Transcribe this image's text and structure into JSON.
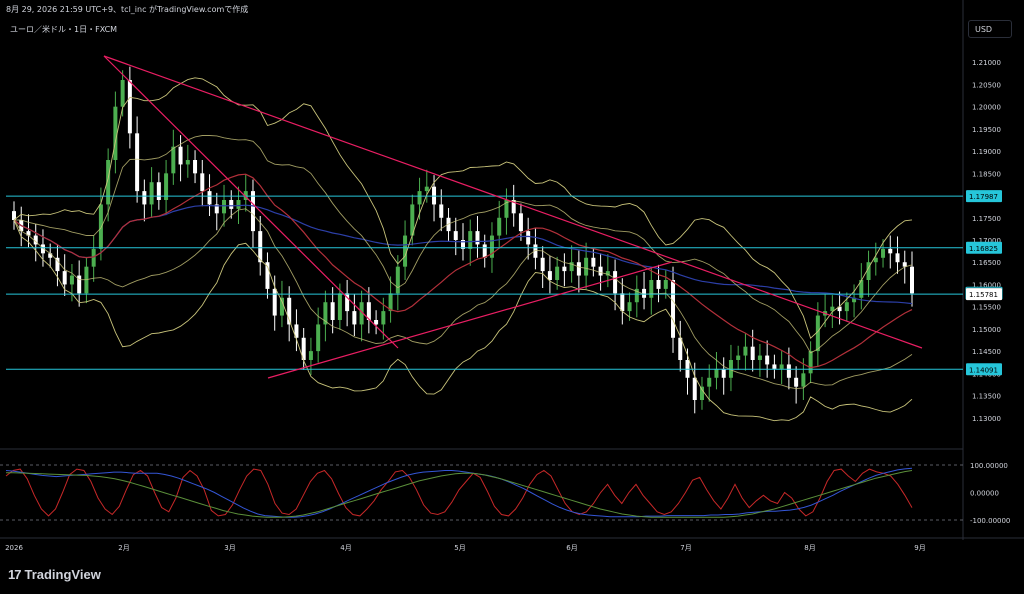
{
  "caption": "8月 29, 2026 21:59 UTC+9、tcl_inc がTradingView.comで作成",
  "symbol_label": "ユーロ／米ドル・1日・FXCM",
  "currency_button": "USD",
  "brand": {
    "mark": "17",
    "name": "TradingView"
  },
  "colors": {
    "background": "#000000",
    "bull": "#4caf50",
    "bear": "#ffffff",
    "hline": "#26c6da",
    "trend": "#e91e63",
    "bb": "#c8c37a",
    "ma_red": "#b2303a",
    "ma_blue": "#2c3fa8",
    "osc_red": "#c62828",
    "osc_blue": "#3456d6",
    "osc_green": "#5b8f3a"
  },
  "chart_data": [
    {
      "type": "candlestick",
      "title": "ユーロ／米ドル・1日・FXCM",
      "ylim": [
        1.125,
        1.215
      ],
      "yticks": [
        "1.21000",
        "1.20500",
        "1.20000",
        "1.19500",
        "1.19000",
        "1.18500",
        "1.18000",
        "1.17500",
        "1.17000",
        "1.16500",
        "1.16000",
        "1.15500",
        "1.15000",
        "1.14500",
        "1.14000",
        "1.13500",
        "1.13000"
      ],
      "xticks": [
        "2026",
        "2月",
        "3月",
        "4月",
        "5月",
        "6月",
        "7月",
        "8月",
        "9月"
      ],
      "price_levels": [
        {
          "label": "1.17987",
          "value": 1.17987
        },
        {
          "label": "1.16825",
          "value": 1.16825
        },
        {
          "label": "1.15801",
          "value": 1.15801,
          "style": "outline"
        },
        {
          "label": "1.15781",
          "value": 1.15781,
          "style": "plain"
        },
        {
          "label": "1.14091",
          "value": 1.14091
        }
      ],
      "close": [
        1.1745,
        1.172,
        1.171,
        1.169,
        1.167,
        1.166,
        1.163,
        1.16,
        1.162,
        1.158,
        1.164,
        1.168,
        1.178,
        1.188,
        1.2,
        1.206,
        1.194,
        1.181,
        1.178,
        1.183,
        1.179,
        1.185,
        1.191,
        1.187,
        1.188,
        1.185,
        1.181,
        1.178,
        1.176,
        1.179,
        1.177,
        1.179,
        1.181,
        1.172,
        1.165,
        1.159,
        1.153,
        1.157,
        1.151,
        1.148,
        1.143,
        1.145,
        1.151,
        1.156,
        1.152,
        1.158,
        1.154,
        1.151,
        1.156,
        1.152,
        1.151,
        1.154,
        1.158,
        1.164,
        1.171,
        1.178,
        1.181,
        1.182,
        1.178,
        1.175,
        1.172,
        1.17,
        1.168,
        1.172,
        1.169,
        1.166,
        1.171,
        1.175,
        1.179,
        1.176,
        1.172,
        1.169,
        1.166,
        1.163,
        1.161,
        1.164,
        1.163,
        1.165,
        1.162,
        1.166,
        1.164,
        1.162,
        1.163,
        1.158,
        1.154,
        1.156,
        1.159,
        1.157,
        1.161,
        1.159,
        1.161,
        1.148,
        1.143,
        1.139,
        1.134,
        1.137,
        1.139,
        1.141,
        1.139,
        1.143,
        1.144,
        1.146,
        1.143,
        1.144,
        1.142,
        1.141,
        1.142,
        1.139,
        1.137,
        1.14,
        1.145,
        1.153,
        1.154,
        1.155,
        1.154,
        1.156,
        1.157,
        1.161,
        1.165,
        1.166,
        1.168,
        1.167,
        1.165,
        1.164,
        1.158
      ]
    },
    {
      "type": "line",
      "title": "",
      "ylim": [
        -100,
        100
      ],
      "yticks": [
        "100.00000",
        "0.00000",
        "-100.00000"
      ],
      "series": [
        {
          "values": [
            60,
            80,
            85,
            50,
            -10,
            -60,
            -85,
            -60,
            0,
            65,
            85,
            80,
            40,
            -20,
            -60,
            -80,
            -50,
            10,
            65,
            80,
            60,
            0,
            -55,
            -70,
            -20,
            55,
            80,
            60,
            10,
            -65,
            -85,
            -80,
            -45,
            10,
            60,
            85,
            80,
            30,
            -40,
            -75,
            -80,
            -60,
            -10,
            40,
            70,
            80,
            50,
            -5,
            -55,
            -80,
            -85,
            -60,
            -30,
            10,
            40,
            75,
            80,
            55,
            10,
            -45,
            -75,
            -80,
            -70,
            -35,
            10,
            40,
            70,
            55,
            5,
            -50,
            -80,
            -85,
            -60,
            -20,
            30,
            65,
            80,
            60,
            10,
            -40,
            -70,
            -80,
            -70,
            -40,
            0,
            30,
            -10,
            -40,
            0,
            30,
            -10,
            -40,
            -70,
            -80,
            -70,
            -40,
            0,
            45,
            55,
            10,
            -30,
            -60,
            -20,
            30,
            -20,
            -55,
            -30,
            -10,
            -30,
            -40,
            0,
            -20,
            -60,
            -85,
            -70,
            -20,
            40,
            80,
            85,
            60,
            40,
            70,
            85,
            75,
            70,
            60,
            30,
            -10,
            -55
          ]
        },
        {
          "values": [
            80,
            78,
            74,
            70,
            66,
            62,
            60,
            58,
            60,
            62,
            64,
            66,
            68,
            70,
            72,
            74,
            74,
            72,
            70,
            70,
            70,
            70,
            66,
            60,
            52,
            42,
            32,
            22,
            12,
            0,
            -14,
            -28,
            -42,
            -56,
            -68,
            -78,
            -84,
            -86,
            -88,
            -90,
            -90,
            -88,
            -84,
            -78,
            -70,
            -60,
            -48,
            -36,
            -24,
            -12,
            0,
            12,
            24,
            36,
            46,
            56,
            64,
            70,
            74,
            76,
            78,
            80,
            80,
            78,
            74,
            70,
            66,
            62,
            56,
            48,
            38,
            26,
            14,
            0,
            -14,
            -28,
            -42,
            -54,
            -64,
            -72,
            -78,
            -82,
            -84,
            -86,
            -88,
            -88,
            -88,
            -88,
            -88,
            -86,
            -86,
            -86,
            -84,
            -84,
            -84,
            -84,
            -84,
            -84,
            -82,
            -82,
            -80,
            -80,
            -78,
            -74,
            -72,
            -70,
            -68,
            -68,
            -66,
            -64,
            -60,
            -54,
            -46,
            -34,
            -22,
            -10,
            4,
            16,
            28,
            40,
            52,
            62,
            70,
            76,
            82,
            86,
            88
          ]
        },
        {
          "values": [
            72,
            72,
            71,
            70,
            69,
            68,
            67,
            66,
            65,
            64,
            63,
            62,
            60,
            58,
            54,
            50,
            44,
            38,
            30,
            22,
            14,
            6,
            -2,
            -10,
            -18,
            -26,
            -34,
            -42,
            -50,
            -58,
            -66,
            -72,
            -78,
            -82,
            -86,
            -88,
            -90,
            -90,
            -90,
            -88,
            -86,
            -82,
            -76,
            -70,
            -62,
            -54,
            -46,
            -38,
            -30,
            -22,
            -14,
            -6,
            2,
            10,
            18,
            26,
            34,
            42,
            48,
            54,
            60,
            64,
            68,
            70,
            70,
            68,
            64,
            58,
            52,
            44,
            36,
            28,
            20,
            12,
            4,
            -4,
            -12,
            -20,
            -28,
            -36,
            -44,
            -52,
            -60,
            -66,
            -72,
            -78,
            -82,
            -86,
            -88,
            -90,
            -90,
            -90,
            -90,
            -90,
            -90,
            -90,
            -90,
            -90,
            -90,
            -90,
            -88,
            -86,
            -82,
            -78,
            -72,
            -66,
            -60,
            -52,
            -44,
            -36,
            -28,
            -20,
            -12,
            -4,
            4,
            12,
            20,
            28,
            36,
            44,
            52,
            58,
            64,
            70,
            76,
            80
          ]
        }
      ]
    }
  ]
}
